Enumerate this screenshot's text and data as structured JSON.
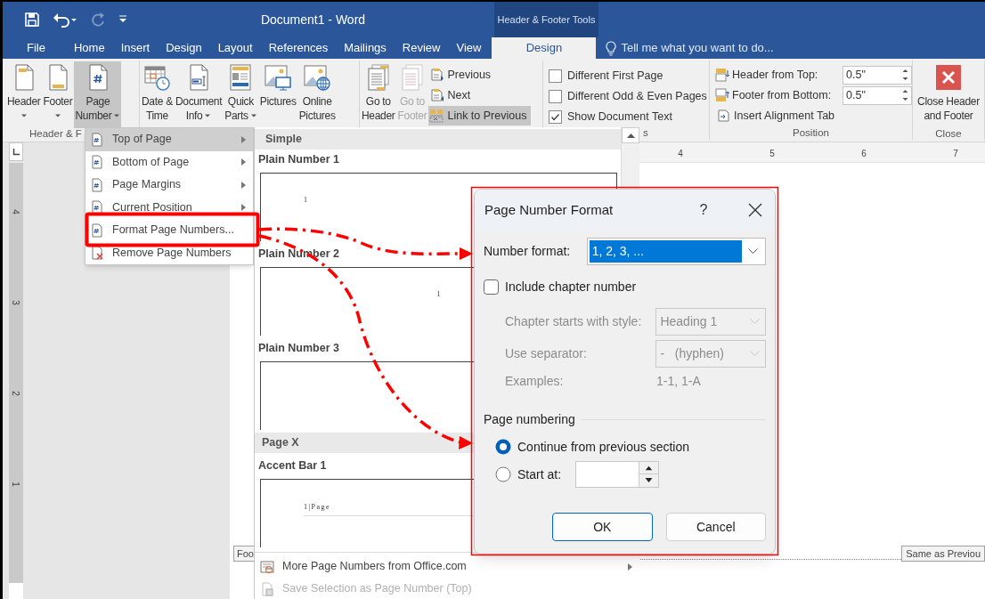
{
  "quick_access": [
    {
      "kind": "save",
      "disabled": false
    },
    {
      "kind": "undo",
      "disabled": false
    },
    {
      "kind": "redo",
      "disabled": true
    },
    {
      "kind": "customize",
      "disabled": false
    }
  ],
  "window": {
    "title": "Document1 - Word",
    "context_title": "Header & Footer Tools"
  },
  "tabs": [
    {
      "label": "File",
      "selected": false
    },
    {
      "label": "Home",
      "selected": false
    },
    {
      "label": "Insert",
      "selected": false
    },
    {
      "label": "Design",
      "selected": false
    },
    {
      "label": "Layout",
      "selected": false
    },
    {
      "label": "References",
      "selected": false
    },
    {
      "label": "Mailings",
      "selected": false
    },
    {
      "label": "Review",
      "selected": false
    },
    {
      "label": "View",
      "selected": false
    },
    {
      "label": "Design",
      "selected": true
    }
  ],
  "tell_me": {
    "placeholder": "Tell me what you want to do..."
  },
  "ribbon": {
    "groups": [
      {
        "label": "Header & F",
        "items": [
          {
            "kind": "large",
            "lines": [
              "Header"
            ],
            "dropdown": true,
            "pressed": false,
            "disabled": false
          },
          {
            "kind": "large",
            "lines": [
              "Footer"
            ],
            "dropdown": true,
            "pressed": false,
            "disabled": false
          },
          {
            "kind": "large",
            "lines": [
              "Page",
              "Number"
            ],
            "dropdown": true,
            "pressed": true,
            "disabled": false
          }
        ]
      },
      {
        "items": [
          {
            "kind": "large",
            "lines": [
              "Date &",
              "Time"
            ],
            "dropdown": false,
            "pressed": false,
            "disabled": false
          },
          {
            "kind": "large",
            "lines": [
              "Document",
              "Info"
            ],
            "dropdown": true,
            "pressed": false,
            "disabled": false
          },
          {
            "kind": "large",
            "lines": [
              "Quick",
              "Parts"
            ],
            "dropdown": true,
            "pressed": false,
            "disabled": false
          },
          {
            "kind": "large",
            "lines": [
              "Pictures"
            ],
            "dropdown": false,
            "pressed": false,
            "disabled": false
          },
          {
            "kind": "large",
            "lines": [
              "Online",
              "Pictures"
            ],
            "dropdown": false,
            "pressed": false,
            "disabled": false
          }
        ]
      },
      {
        "items": [
          {
            "kind": "large",
            "lines": [
              "Go to",
              "Header"
            ],
            "dropdown": false,
            "pressed": false,
            "disabled": false
          },
          {
            "kind": "large",
            "lines": [
              "Go to",
              "Footer"
            ],
            "dropdown": false,
            "pressed": false,
            "disabled": true
          },
          {
            "kind": "small",
            "label": "Previous",
            "pressed": false,
            "disabled": false
          },
          {
            "kind": "small",
            "label": "Next",
            "pressed": false,
            "disabled": false
          },
          {
            "kind": "small",
            "label": "Link to Previous",
            "pressed": true,
            "disabled": false
          }
        ]
      },
      {
        "label": "s",
        "items": [
          {
            "kind": "checkbox",
            "label": "Different First Page",
            "checked": false
          },
          {
            "kind": "checkbox",
            "label": "Different Odd & Even Pages",
            "checked": false
          },
          {
            "kind": "checkbox",
            "label": "Show Document Text",
            "checked": true
          }
        ]
      },
      {
        "label": "Position",
        "items": [
          {
            "kind": "spin",
            "label": "Header from Top:",
            "value": "0.5\""
          },
          {
            "kind": "spin",
            "label": "Footer from Bottom:",
            "value": "0.5\""
          },
          {
            "kind": "small",
            "label": "Insert Alignment Tab",
            "pressed": false,
            "disabled": false
          }
        ]
      },
      {
        "label": "Close",
        "items": [
          {
            "kind": "large",
            "lines": [
              "Close Header",
              "and Footer"
            ],
            "dropdown": false,
            "pressed": false,
            "disabled": false
          }
        ]
      }
    ]
  },
  "ruler": {
    "horizontal": [
      "4",
      "5",
      "6",
      "7"
    ],
    "vertical": [
      "4",
      "3",
      "2",
      "1"
    ]
  },
  "document": {
    "footer_tag": "Foo",
    "link_tag": "Same as Previou"
  },
  "page_number_menu": {
    "items": [
      {
        "label": "Top of Page",
        "submenu": true,
        "selected": true
      },
      {
        "label": "Bottom of Page",
        "submenu": true,
        "selected": false
      },
      {
        "label": "Page Margins",
        "submenu": true,
        "selected": false
      },
      {
        "label": "Current Position",
        "submenu": true,
        "selected": false
      },
      {
        "label": "Format Page Numbers...",
        "submenu": false,
        "selected": false
      },
      {
        "label": "Remove Page Numbers",
        "submenu": false,
        "selected": false
      }
    ]
  },
  "gallery": {
    "sections": [
      {
        "kind": "heading",
        "label": "Simple"
      },
      {
        "kind": "preview",
        "label": "Plain Number 1",
        "sample": "1",
        "centered": false
      },
      {
        "kind": "preview",
        "label": "Plain Number 2",
        "sample": "1",
        "centered": true
      },
      {
        "kind": "preview",
        "label": "Plain Number 3"
      },
      {
        "kind": "heading",
        "label": "Page X"
      },
      {
        "kind": "accent",
        "label": "Accent Bar 1",
        "sample": "1|Page",
        "centered": false
      }
    ],
    "footer": [
      {
        "label": "More Page Numbers from Office.com",
        "submenu": true,
        "disabled": false
      },
      {
        "label": "Save Selection as Page Number (Top)",
        "submenu": false,
        "disabled": true
      }
    ]
  },
  "dialog": {
    "title": "Page Number Format",
    "help": "?",
    "number_format": {
      "label": "Number format:",
      "value": "1, 2, 3, ..."
    },
    "include_chapter": {
      "label": "Include chapter number",
      "checked": false
    },
    "chapter_style": {
      "label": "Chapter starts with style:",
      "value": "Heading 1",
      "disabled": true
    },
    "separator": {
      "label": "Use separator:",
      "value": "-   (hyphen)",
      "disabled": true
    },
    "examples": {
      "label": "Examples:",
      "value": "1-1, 1-A",
      "disabled": true
    },
    "page_numbering": {
      "heading": "Page numbering",
      "options": [
        {
          "label": "Continue from previous section",
          "selected": true
        },
        {
          "label": "Start at:",
          "selected": false
        }
      ]
    },
    "buttons": [
      {
        "label": "OK",
        "default": true
      },
      {
        "label": "Cancel",
        "default": false
      }
    ]
  }
}
